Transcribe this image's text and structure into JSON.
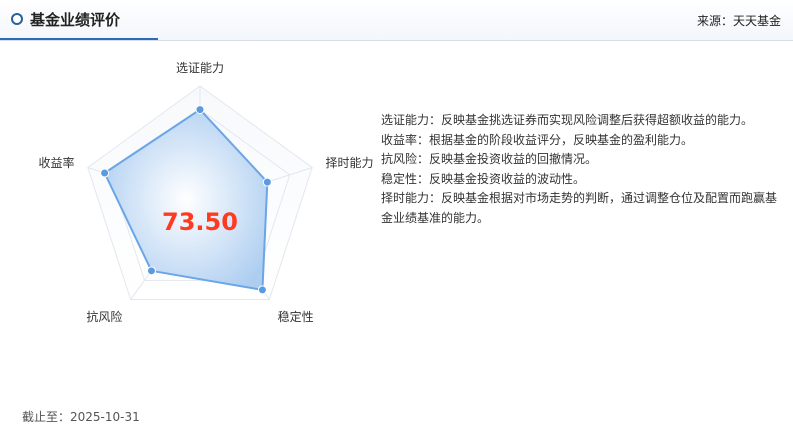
{
  "header": {
    "title": "基金业绩评价",
    "source": "来源：天天基金"
  },
  "chart_data": {
    "type": "radar",
    "score": "73.50",
    "max": 100,
    "axes": [
      "选证能力",
      "择时能力",
      "稳定性",
      "抗风险",
      "收益率"
    ],
    "values": [
      80,
      60,
      90,
      70,
      85
    ],
    "grid": true,
    "colors": {
      "area": "#a9cbf0",
      "line": "#6aa5e6",
      "point": "#5a9ae0",
      "score": "#ff3b1f"
    }
  },
  "descriptions": [
    "选证能力：反映基金挑选证券而实现风险调整后获得超额收益的能力。",
    "收益率：根据基金的阶段收益评分，反映基金的盈利能力。",
    "抗风险：反映基金投资收益的回撤情况。",
    "稳定性：反映基金投资收益的波动性。",
    "择时能力：反映基金根据对市场走势的判断，通过调整仓位及配置而跑赢基金业绩基准的能力。"
  ],
  "footer": {
    "date": "截止至：2025-10-31"
  }
}
